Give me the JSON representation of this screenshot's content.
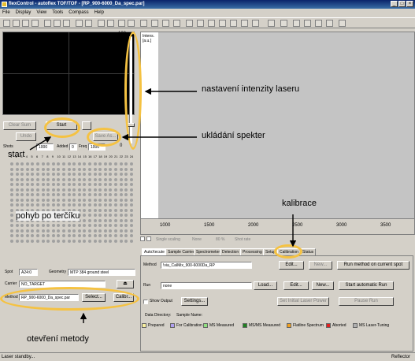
{
  "window": {
    "title": "flexControl - autoflex TOF/TOF - [RP_900-6000_Da_spec.par]"
  },
  "menu": [
    "File",
    "Display",
    "View",
    "Tools",
    "Compass",
    "Help"
  ],
  "video_controls": {
    "clear_sum": "Clear Sum",
    "start": "Start",
    "undo": "Undo",
    "save_as": "Save As...",
    "shots_label": "Shots",
    "shots_value": "1000",
    "added_label": "Added",
    "added_value": "0",
    "freq_label": "Freq",
    "freq_value": "1000"
  },
  "laser": {
    "max_label": "100",
    "min_label": "0"
  },
  "plate": {
    "col_numbers": [
      "1",
      "2",
      "3",
      "4",
      "5",
      "6",
      "7",
      "8",
      "9",
      "10",
      "11",
      "12",
      "13",
      "14",
      "15",
      "16",
      "17",
      "18",
      "19",
      "20",
      "21",
      "22",
      "23",
      "24"
    ],
    "spot_label": "Spot",
    "spot_value": "A24:0",
    "geometry_label": "Geometry",
    "geometry_value": "MTP 384 ground steel",
    "carrier_label": "Carrier",
    "carrier_value": "NO_TARGET",
    "method_label": "Method",
    "method_value": "RP_900-6000_Da_spec.par",
    "select_button": "Select...",
    "calib_button": "Calibr..."
  },
  "spectrum": {
    "y_axis_title": "Intens.",
    "y_axis_unit": "[a.u.]",
    "x_ticks": [
      "1000",
      "1500",
      "2000",
      "2500",
      "3000",
      "3500"
    ],
    "scaling_options": [
      "Single scaling",
      "None",
      "80 %",
      "Shot rate"
    ]
  },
  "tabs": [
    "AutoXecute",
    "Sample Carrier",
    "Spectrometer",
    "Detection",
    "Processing",
    "Setup",
    "Calibration",
    "Status"
  ],
  "panel": {
    "method_label": "Method",
    "method_value": "!via_CalMix_900-6000Da_RP",
    "edit": "Edit...",
    "new": "New...",
    "run_method_current": "Run method on current spot",
    "run_label": "Run",
    "run_value": "none",
    "load": "Load...",
    "edit2": "Edit...",
    "new2": "New...",
    "start_auto_run": "Start automatic Run",
    "show_output": "Show Output",
    "settings": "Settings...",
    "set_initial_laser": "Set Initial Laser Power",
    "pause_run": "Pause Run",
    "data_directory_label": "Data Directory:",
    "sample_name_label": "Sample Name:"
  },
  "legend": [
    {
      "label": "Prepared",
      "color": "#f8f0a0"
    },
    {
      "label": "For Calibration",
      "color": "#b0a0f0"
    },
    {
      "label": "MS Measured",
      "color": "#90e080"
    },
    {
      "label": "MS/MS Measured",
      "color": "#208020"
    },
    {
      "label": "Flatline Spectrum",
      "color": "#f0a020"
    },
    {
      "label": "Aborted",
      "color": "#e02020"
    },
    {
      "label": "MS Laser-Tuning",
      "color": "#b0b0b0"
    }
  ],
  "status": {
    "left": "Laser standby...",
    "right": "Reflector"
  },
  "annotations": {
    "laser": "nastavení intenzity laseru",
    "saving": "ukládání spekter",
    "start": "start",
    "plate": "pohyb po terčíku",
    "calibration": "kalibrace",
    "method": "otevření metody"
  },
  "colors": {
    "highlight": "#f5c242",
    "title_bar": "#0a246a"
  }
}
